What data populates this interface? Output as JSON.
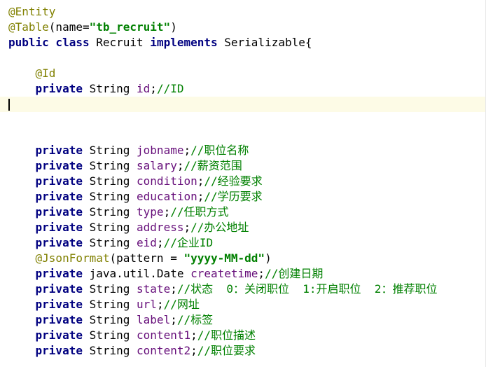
{
  "editor": {
    "lines": [
      {
        "parts": [
          {
            "t": "@Entity",
            "c": "ann"
          }
        ]
      },
      {
        "parts": [
          {
            "t": "@Table",
            "c": "ann"
          },
          {
            "t": "(name=",
            "c": "plain"
          },
          {
            "t": "\"tb_recruit\"",
            "c": "str"
          },
          {
            "t": ")",
            "c": "plain"
          }
        ]
      },
      {
        "parts": [
          {
            "t": "public class ",
            "c": "kw"
          },
          {
            "t": "Recruit ",
            "c": "plain"
          },
          {
            "t": "implements ",
            "c": "kw"
          },
          {
            "t": "Serializable{",
            "c": "plain"
          }
        ]
      },
      {
        "parts": []
      },
      {
        "parts": [
          {
            "t": "    ",
            "c": "plain"
          },
          {
            "t": "@Id",
            "c": "ann"
          }
        ]
      },
      {
        "parts": [
          {
            "t": "    ",
            "c": "plain"
          },
          {
            "t": "private ",
            "c": "kw"
          },
          {
            "t": "String ",
            "c": "plain"
          },
          {
            "t": "id",
            "c": "field"
          },
          {
            "t": ";",
            "c": "plain"
          },
          {
            "t": "//ID",
            "c": "cm"
          }
        ]
      },
      {
        "parts": [],
        "current": true
      },
      {
        "parts": []
      },
      {
        "parts": []
      },
      {
        "parts": [
          {
            "t": "    ",
            "c": "plain"
          },
          {
            "t": "private ",
            "c": "kw"
          },
          {
            "t": "String ",
            "c": "plain"
          },
          {
            "t": "jobname",
            "c": "field"
          },
          {
            "t": ";",
            "c": "plain"
          },
          {
            "t": "//职位名称",
            "c": "cm"
          }
        ]
      },
      {
        "parts": [
          {
            "t": "    ",
            "c": "plain"
          },
          {
            "t": "private ",
            "c": "kw"
          },
          {
            "t": "String ",
            "c": "plain"
          },
          {
            "t": "salary",
            "c": "field"
          },
          {
            "t": ";",
            "c": "plain"
          },
          {
            "t": "//薪资范围",
            "c": "cm"
          }
        ]
      },
      {
        "parts": [
          {
            "t": "    ",
            "c": "plain"
          },
          {
            "t": "private ",
            "c": "kw"
          },
          {
            "t": "String ",
            "c": "plain"
          },
          {
            "t": "condition",
            "c": "field"
          },
          {
            "t": ";",
            "c": "plain"
          },
          {
            "t": "//经验要求",
            "c": "cm"
          }
        ]
      },
      {
        "parts": [
          {
            "t": "    ",
            "c": "plain"
          },
          {
            "t": "private ",
            "c": "kw"
          },
          {
            "t": "String ",
            "c": "plain"
          },
          {
            "t": "education",
            "c": "field"
          },
          {
            "t": ";",
            "c": "plain"
          },
          {
            "t": "//学历要求",
            "c": "cm"
          }
        ]
      },
      {
        "parts": [
          {
            "t": "    ",
            "c": "plain"
          },
          {
            "t": "private ",
            "c": "kw"
          },
          {
            "t": "String ",
            "c": "plain"
          },
          {
            "t": "type",
            "c": "field"
          },
          {
            "t": ";",
            "c": "plain"
          },
          {
            "t": "//任职方式",
            "c": "cm"
          }
        ]
      },
      {
        "parts": [
          {
            "t": "    ",
            "c": "plain"
          },
          {
            "t": "private ",
            "c": "kw"
          },
          {
            "t": "String ",
            "c": "plain"
          },
          {
            "t": "address",
            "c": "field"
          },
          {
            "t": ";",
            "c": "plain"
          },
          {
            "t": "//办公地址",
            "c": "cm"
          }
        ]
      },
      {
        "parts": [
          {
            "t": "    ",
            "c": "plain"
          },
          {
            "t": "private ",
            "c": "kw"
          },
          {
            "t": "String ",
            "c": "plain"
          },
          {
            "t": "eid",
            "c": "field"
          },
          {
            "t": ";",
            "c": "plain"
          },
          {
            "t": "//企业ID",
            "c": "cm"
          }
        ]
      },
      {
        "parts": [
          {
            "t": "    ",
            "c": "plain"
          },
          {
            "t": "@JsonFormat",
            "c": "ann"
          },
          {
            "t": "(pattern = ",
            "c": "plain"
          },
          {
            "t": "\"yyyy-MM-dd\"",
            "c": "str"
          },
          {
            "t": ")",
            "c": "plain"
          }
        ]
      },
      {
        "parts": [
          {
            "t": "    ",
            "c": "plain"
          },
          {
            "t": "private ",
            "c": "kw"
          },
          {
            "t": "java.util.Date ",
            "c": "plain"
          },
          {
            "t": "createtime",
            "c": "field"
          },
          {
            "t": ";",
            "c": "plain"
          },
          {
            "t": "//创建日期",
            "c": "cm"
          }
        ]
      },
      {
        "parts": [
          {
            "t": "    ",
            "c": "plain"
          },
          {
            "t": "private ",
            "c": "kw"
          },
          {
            "t": "String ",
            "c": "plain"
          },
          {
            "t": "state",
            "c": "field"
          },
          {
            "t": ";",
            "c": "plain"
          },
          {
            "t": "//状态  0：关闭职位  1:开启职位  2：推荐职位",
            "c": "cm"
          }
        ]
      },
      {
        "parts": [
          {
            "t": "    ",
            "c": "plain"
          },
          {
            "t": "private ",
            "c": "kw"
          },
          {
            "t": "String ",
            "c": "plain"
          },
          {
            "t": "url",
            "c": "field"
          },
          {
            "t": ";",
            "c": "plain"
          },
          {
            "t": "//网址",
            "c": "cm"
          }
        ]
      },
      {
        "parts": [
          {
            "t": "    ",
            "c": "plain"
          },
          {
            "t": "private ",
            "c": "kw"
          },
          {
            "t": "String ",
            "c": "plain"
          },
          {
            "t": "label",
            "c": "field"
          },
          {
            "t": ";",
            "c": "plain"
          },
          {
            "t": "//标签",
            "c": "cm"
          }
        ]
      },
      {
        "parts": [
          {
            "t": "    ",
            "c": "plain"
          },
          {
            "t": "private ",
            "c": "kw"
          },
          {
            "t": "String ",
            "c": "plain"
          },
          {
            "t": "content1",
            "c": "field"
          },
          {
            "t": ";",
            "c": "plain"
          },
          {
            "t": "//职位描述",
            "c": "cm"
          }
        ]
      },
      {
        "parts": [
          {
            "t": "    ",
            "c": "plain"
          },
          {
            "t": "private ",
            "c": "kw"
          },
          {
            "t": "String ",
            "c": "plain"
          },
          {
            "t": "content2",
            "c": "field"
          },
          {
            "t": ";",
            "c": "plain"
          },
          {
            "t": "//职位要求",
            "c": "cm"
          }
        ]
      }
    ]
  }
}
